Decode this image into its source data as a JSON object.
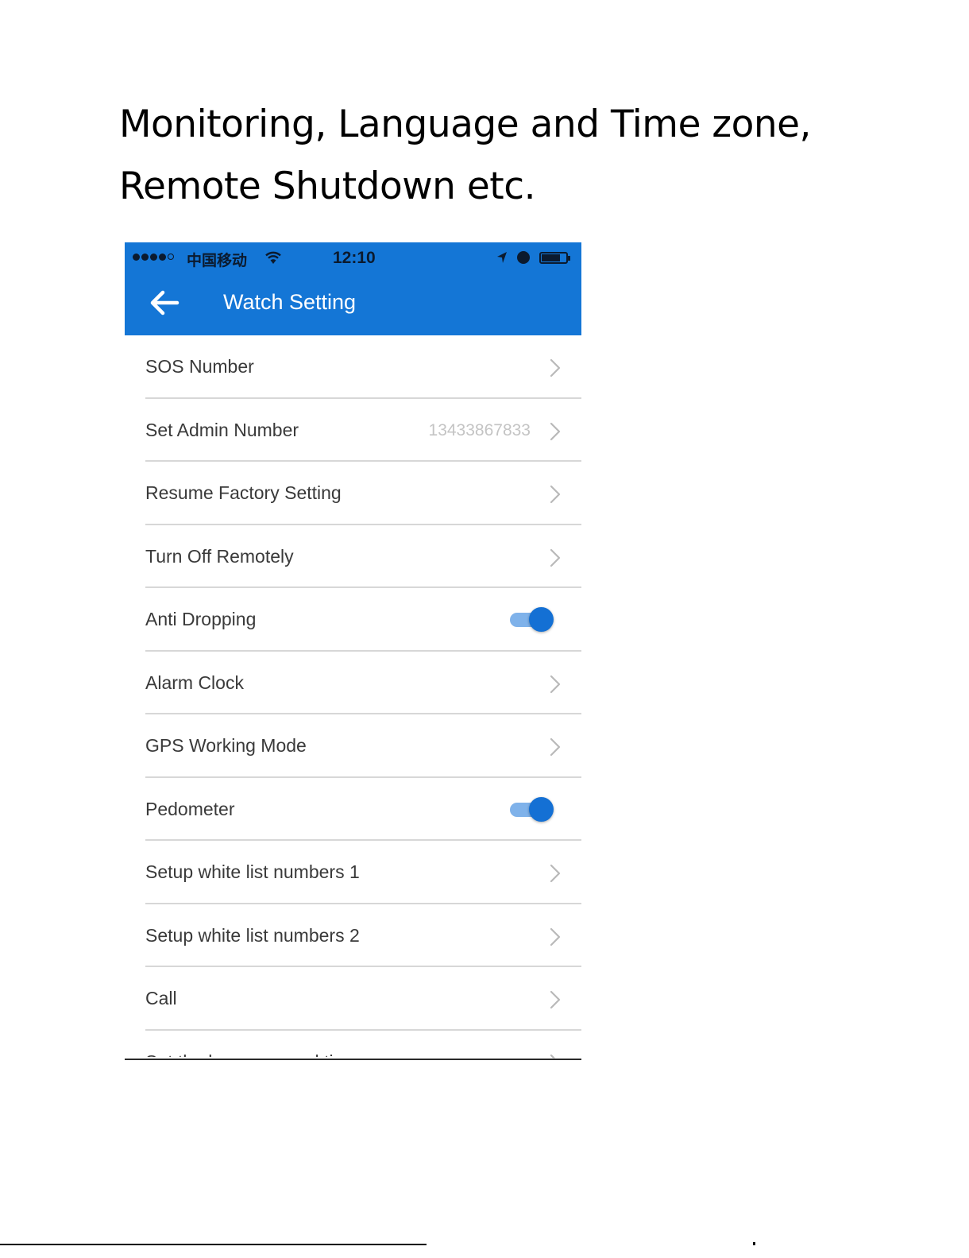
{
  "heading": {
    "line1": "Monitoring, Language and Time zone,",
    "line2": "Remote Shutdown etc."
  },
  "status_bar": {
    "carrier": "中国移动",
    "time": "12:10",
    "icons": [
      "signal-dots-icon",
      "wifi-icon",
      "location-arrow-icon",
      "alarm-icon",
      "battery-icon"
    ]
  },
  "app_bar": {
    "title": "Watch Setting",
    "back_icon": "arrow-left-icon",
    "color": "#1476d6"
  },
  "settings": [
    {
      "label": "SOS Number",
      "control": "chevron"
    },
    {
      "label": "Set Admin Number",
      "value": "13433867833",
      "control": "chevron"
    },
    {
      "label": "Resume Factory Setting",
      "control": "chevron"
    },
    {
      "label": "Turn Off Remotely",
      "control": "chevron"
    },
    {
      "label": "Anti Dropping",
      "control": "toggle",
      "on": true
    },
    {
      "label": "Alarm Clock",
      "control": "chevron"
    },
    {
      "label": "GPS Working Mode",
      "control": "chevron"
    },
    {
      "label": "Pedometer",
      "control": "toggle",
      "on": true
    },
    {
      "label": "Setup white list numbers 1",
      "control": "chevron"
    },
    {
      "label": "Setup white list numbers 2",
      "control": "chevron"
    },
    {
      "label": "Call",
      "control": "chevron"
    }
  ],
  "partial_row": {
    "label": "Set the language and time zone"
  }
}
